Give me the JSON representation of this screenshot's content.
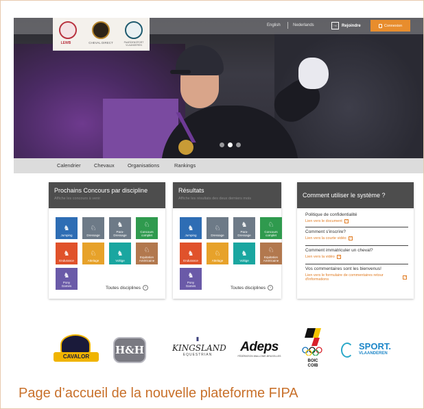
{
  "header": {
    "lang_en": "English",
    "lang_nl": "Nederlands",
    "join_label": "Rejoindre",
    "connect_label": "Connexion",
    "logos": [
      {
        "name": "LEWB",
        "label": "LEWB",
        "color": "#b8323f"
      },
      {
        "name": "Cheval Direct",
        "label": "CHEVAL DIRECT",
        "color": "#b5842b"
      },
      {
        "name": "Paardensport Vlaanderen",
        "label": "PAARDENSPORT VLAANDEREN",
        "color": "#1e5a6e"
      }
    ]
  },
  "hero": {
    "slides": 3,
    "active_slide": 2
  },
  "nav": {
    "items": [
      "Calendrier",
      "Chevaux",
      "Organisations",
      "Rankings"
    ]
  },
  "panels": {
    "contests": {
      "title": "Prochains Concours par discipline",
      "subtitle": "Affiche les concours à venir",
      "all_label": "Toutes disciplines"
    },
    "results": {
      "title": "Résultats",
      "subtitle": "Affiche les résultats des deux derniers mois",
      "all_label": "Toutes disciplines"
    },
    "help": {
      "title": "Comment utiliser le système ?",
      "items": [
        {
          "title": "Politique de confidentialité",
          "link": "Lien vers le document"
        },
        {
          "title": "Comment s'inscrire?",
          "link": "Lien vers la courte vidéo"
        },
        {
          "title": "Comment immatriculer un cheval?",
          "link": "Lien vers la vidéo"
        },
        {
          "title": "Vos commentaires sont les bienvenus!",
          "link": "Lien vers le formulaire de commentaires retour d'informations"
        }
      ]
    }
  },
  "disciplines": [
    {
      "name": "Jumping",
      "color": "#2e6db4"
    },
    {
      "name": "Dressage",
      "color": "#6d7a87"
    },
    {
      "name": "Para-\nDressage",
      "color": "#6d7a87"
    },
    {
      "name": "Concours\ncomplet",
      "color": "#2f9a4e"
    },
    {
      "name": "Endurance",
      "color": "#e0522b"
    },
    {
      "name": "Attelage",
      "color": "#e7a22a"
    },
    {
      "name": "Voltige",
      "color": "#1aa6a0"
    },
    {
      "name": "Equitation\nAméricaine",
      "color": "#b2784e"
    },
    {
      "name": "Pony\nGames",
      "color": "#6a5aa8"
    }
  ],
  "sponsors": {
    "cavalor": "CAVALOR",
    "hh": "H&H",
    "kingsland": "KINGSLAND",
    "kingsland_sub": "EQUESTRIAN",
    "adeps": "Adeps",
    "adeps_sub": "FÉDÉRATION WALLONIE-BRUXELLES",
    "boic": "BOIC\nCOIB",
    "sport": "SPORT.",
    "sport_sub": "VLAANDEREN"
  },
  "caption": "Page d’accueil de la nouvelle plateforme FIPA"
}
